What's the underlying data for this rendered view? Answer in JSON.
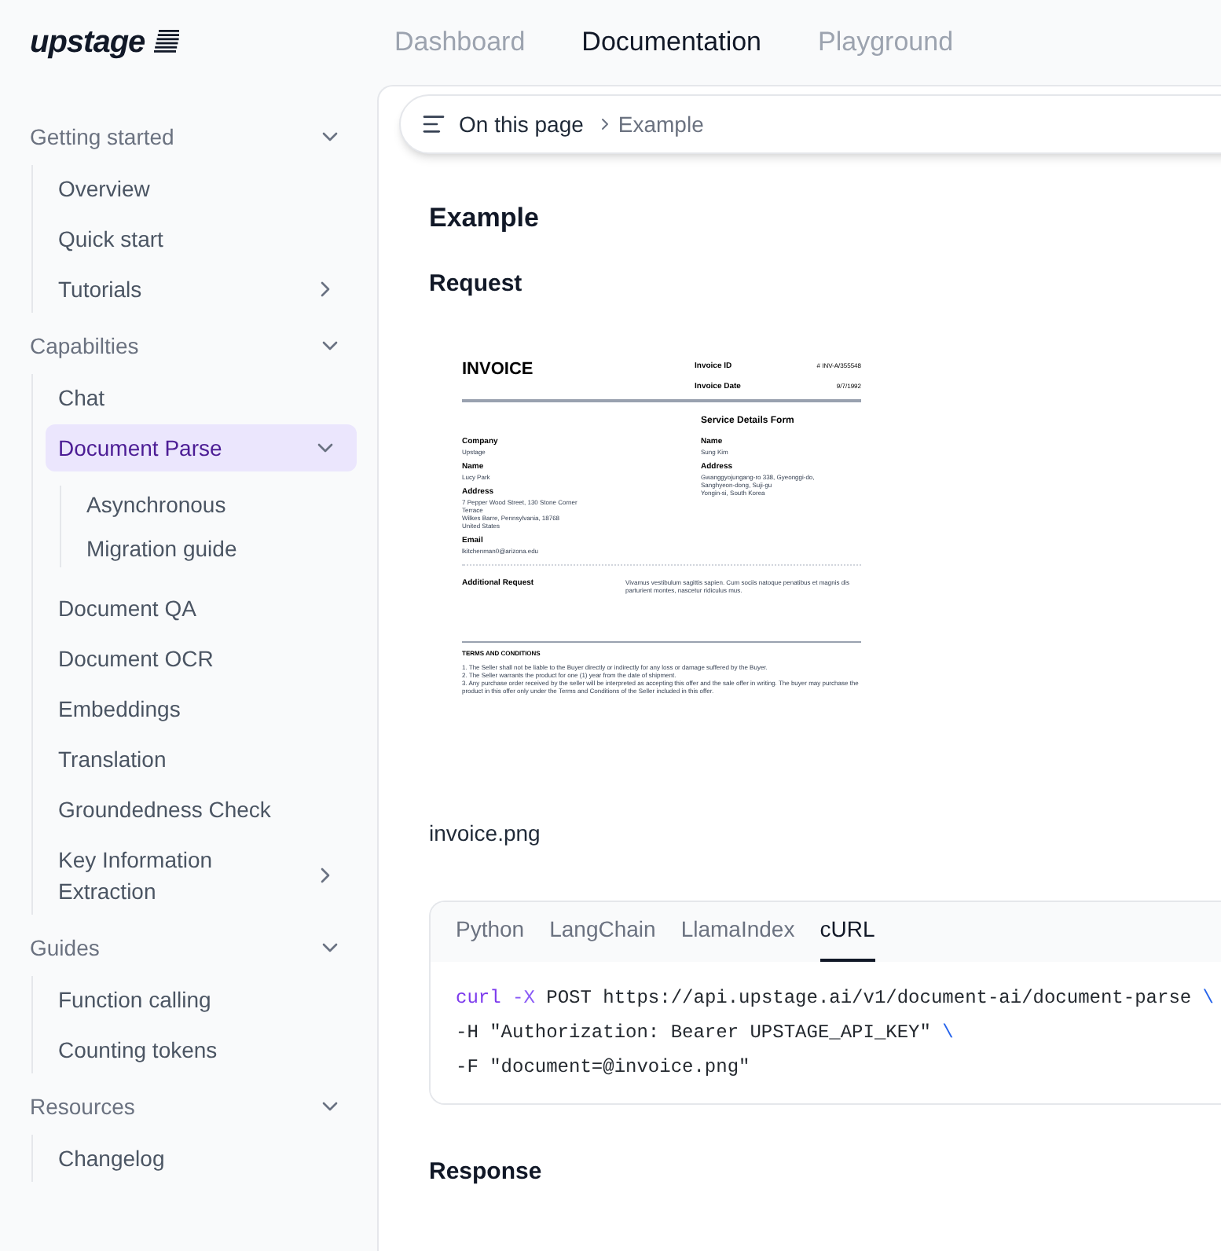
{
  "logo": {
    "text": "upstage"
  },
  "nav": [
    {
      "label": "Dashboard",
      "selected": false
    },
    {
      "label": "Documentation",
      "selected": true
    },
    {
      "label": "Playground",
      "selected": false
    }
  ],
  "sidebar": {
    "sections": [
      {
        "label": "Getting started",
        "expanded": true,
        "items": [
          {
            "label": "Overview",
            "selected": false
          },
          {
            "label": "Quick start",
            "selected": false
          },
          {
            "label": "Tutorials",
            "selected": false,
            "expanded": false
          }
        ]
      },
      {
        "label": "Capabilties",
        "expanded": true,
        "items": [
          {
            "label": "Chat",
            "selected": false
          },
          {
            "label": "Document Parse",
            "selected": true,
            "expanded": true,
            "children": [
              {
                "label": "Asynchronous",
                "selected": false
              },
              {
                "label": "Migration guide",
                "selected": false
              }
            ]
          },
          {
            "label": "Document QA",
            "selected": false
          },
          {
            "label": "Document OCR",
            "selected": false
          },
          {
            "label": "Embeddings",
            "selected": false
          },
          {
            "label": "Translation",
            "selected": false
          },
          {
            "label": "Groundedness Check",
            "selected": false
          },
          {
            "label": "Key Information Extraction",
            "selected": false,
            "expanded": false
          }
        ]
      },
      {
        "label": "Guides",
        "expanded": true,
        "items": [
          {
            "label": "Function calling",
            "selected": false
          },
          {
            "label": "Counting tokens",
            "selected": false
          }
        ]
      },
      {
        "label": "Resources",
        "expanded": true,
        "items": [
          {
            "label": "Changelog",
            "selected": false
          }
        ]
      }
    ]
  },
  "breadcrumb": {
    "label": "On this page",
    "current": "Example"
  },
  "content": {
    "heading": "Example",
    "request_heading": "Request",
    "invoice": {
      "title": "INVOICE",
      "id_label": "Invoice ID",
      "id_value": "# INV-A/355548",
      "date_label": "Invoice Date",
      "date_value": "9/7/1992",
      "form_title": "Service Details Form",
      "left": [
        {
          "label": "Company",
          "lines": [
            "Upstage"
          ]
        },
        {
          "label": "Name",
          "lines": [
            "Lucy Park"
          ]
        },
        {
          "label": "Address",
          "lines": [
            "7 Pepper Wood Street, 130 Stone Corner",
            "Terrace",
            "Wilkes Barre, Pennsylvania, 18768",
            "United States"
          ]
        },
        {
          "label": "Email",
          "lines": [
            "lkitchenman0@arizona.edu"
          ]
        }
      ],
      "right": [
        {
          "label": "Name",
          "lines": [
            "Sung Kim"
          ]
        },
        {
          "label": "Address",
          "lines": [
            "Gwanggyojungang-ro 338, Gyeonggi-do,",
            "Sanghyeon-dong, Suji-gu",
            "Yongin-si, South Korea"
          ]
        }
      ],
      "request_label": "Additional Request",
      "request_text": "Vivamus vestibulum sagittis sapien. Cum sociis natoque penatibus et magnis dis parturient montes, nascetur ridiculus mus.",
      "terms_title": "TERMS AND CONDITIONS",
      "terms": [
        "1. The Seller shall not be liable to the Buyer directly or indirectly for any loss or damage suffered by the Buyer.",
        "2. The Seller warrants the product for one (1) year from the date of shipment.",
        "3. Any purchase order received by the seller will be interpreted as accepting this offer and the sale offer in writing. The buyer may purchase the product in this offer only under the Terms and Conditions of the Seller included in this offer."
      ]
    },
    "caption": "invoice.png",
    "code_tabs": [
      {
        "label": "Python",
        "selected": false
      },
      {
        "label": "LangChain",
        "selected": false
      },
      {
        "label": "LlamaIndex",
        "selected": false
      },
      {
        "label": "cURL",
        "selected": true
      }
    ],
    "code_lines": [
      [
        {
          "text": "curl",
          "kind": "command"
        },
        {
          "text": " -X",
          "kind": "flag"
        },
        {
          "text": " POST https://api.upstage.ai/v1/document-ai/document-parse ",
          "kind": "plain"
        },
        {
          "text": "\\",
          "kind": "escape"
        }
      ],
      [
        {
          "text": "-H \"Authorization: Bearer UPSTAGE_API_KEY\" ",
          "kind": "plain"
        },
        {
          "text": "\\",
          "kind": "escape"
        }
      ],
      [
        {
          "text": "-F \"document=@invoice.png\"",
          "kind": "plain"
        }
      ]
    ],
    "response_heading": "Response"
  }
}
